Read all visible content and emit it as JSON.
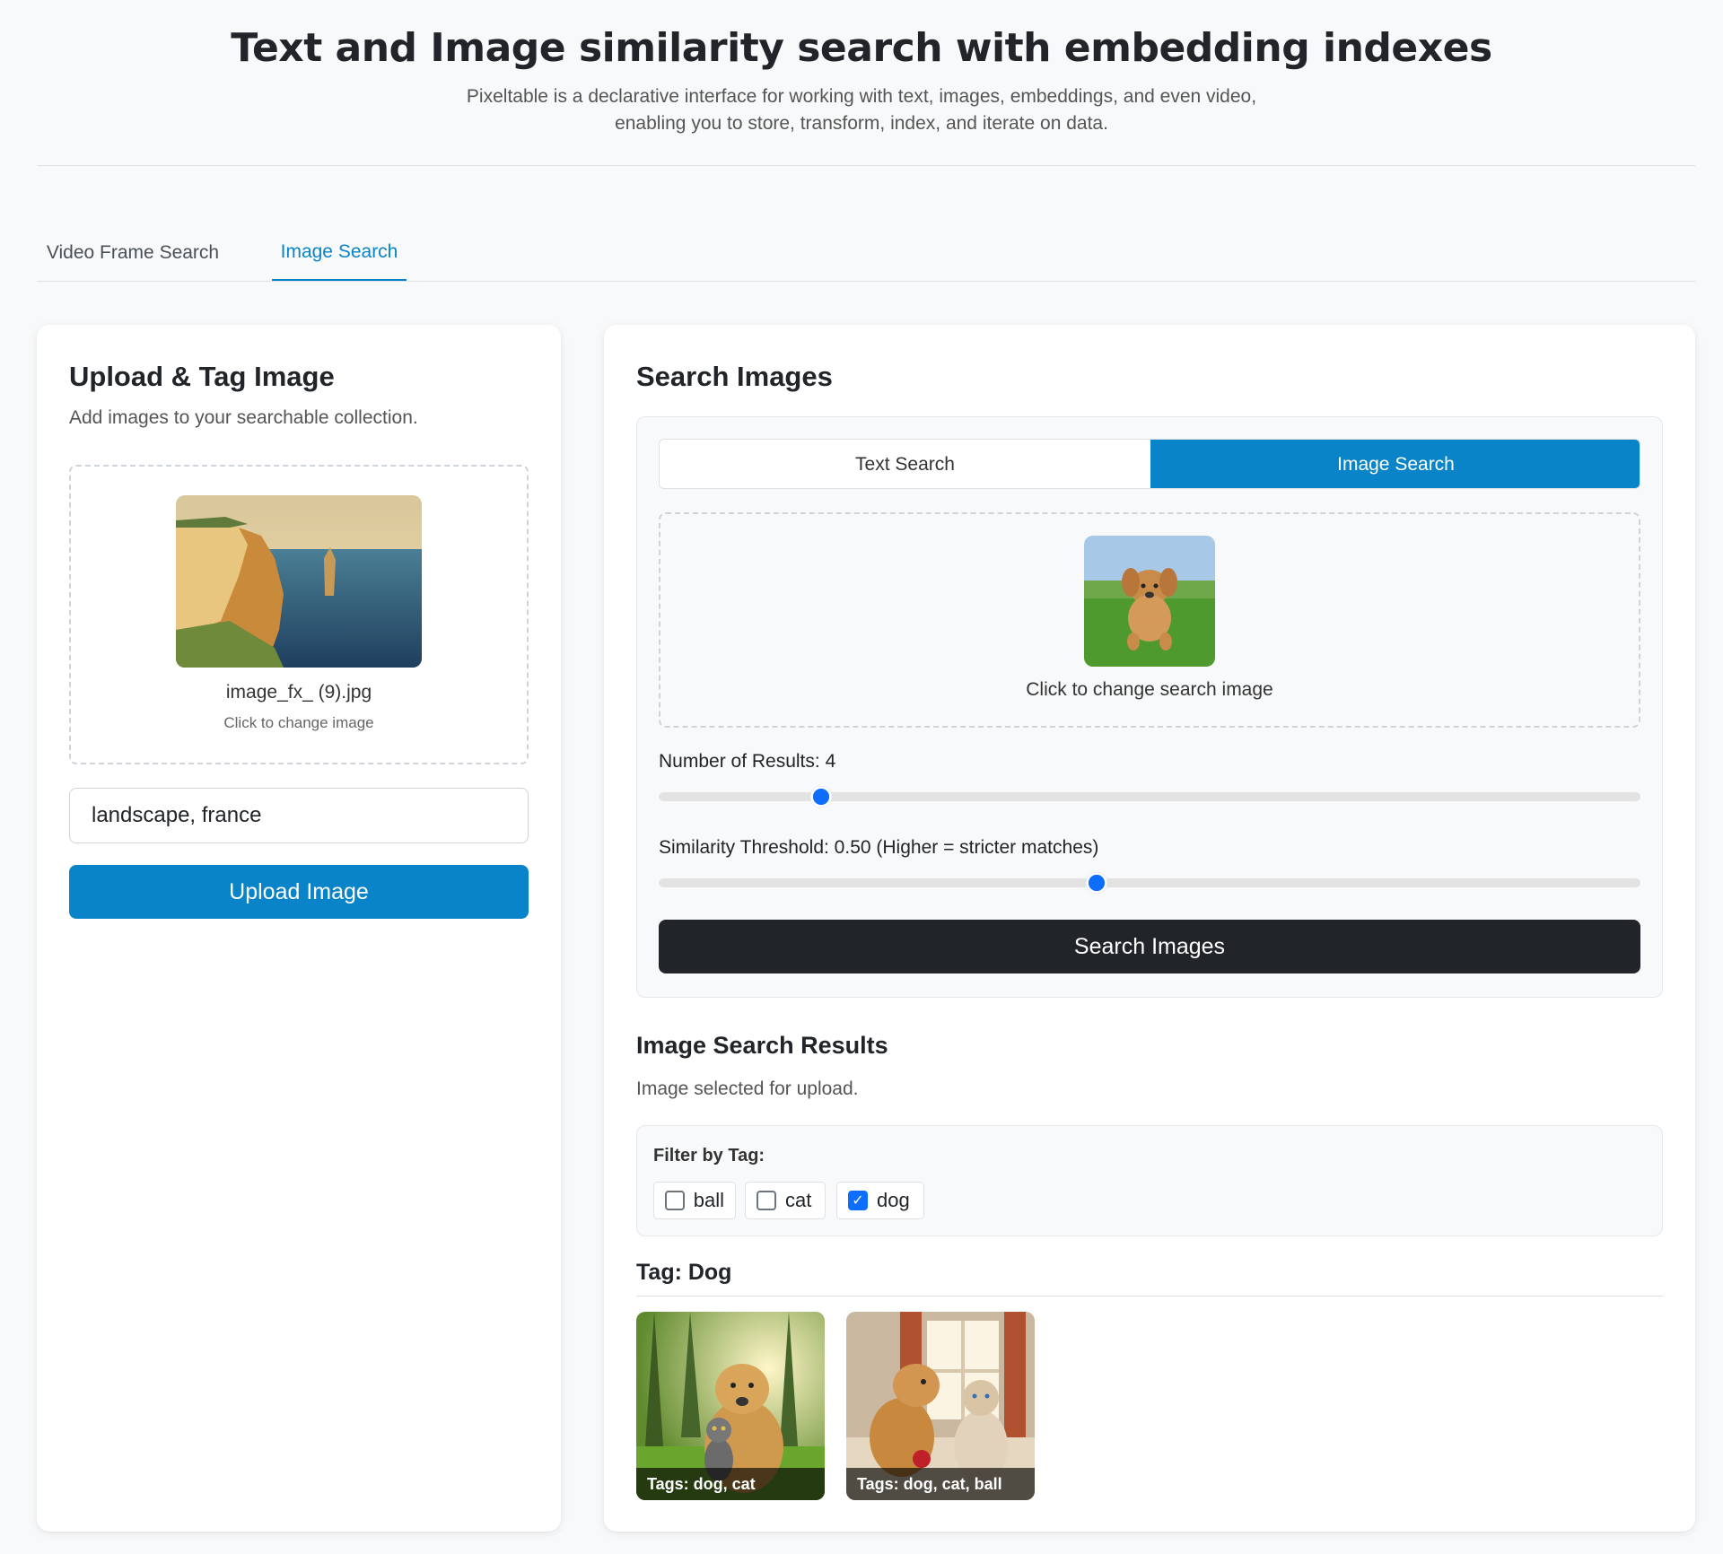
{
  "header": {
    "title": "Text and Image similarity search with embedding indexes",
    "subtitle": "Pixeltable is a declarative interface for working with text, images, embeddings, and even video,\nenabling you to store, transform, index, and iterate on data."
  },
  "tabs": [
    {
      "label": "Video Frame Search",
      "active": false
    },
    {
      "label": "Image Search",
      "active": true
    }
  ],
  "upload_panel": {
    "title": "Upload & Tag Image",
    "description": "Add images to your searchable collection.",
    "file_name": "image_fx_ (9).jpg",
    "change_hint": "Click to change image",
    "tags_value": "landscape, france",
    "upload_button": "Upload Image"
  },
  "search_panel": {
    "title": "Search Images",
    "mode_tabs": [
      {
        "label": "Text Search",
        "active": false
      },
      {
        "label": "Image Search",
        "active": true
      }
    ],
    "change_search_hint": "Click to change search image",
    "num_results_label": "Number of Results: 4",
    "num_results": {
      "value": 4,
      "fraction": 0.165
    },
    "threshold_label": "Similarity Threshold: 0.50 (Higher = stricter matches)",
    "threshold": {
      "value": 0.5,
      "fraction": 0.446
    },
    "search_button": "Search Images"
  },
  "results": {
    "title": "Image Search Results",
    "status": "Image selected for upload.",
    "filter_label": "Filter by Tag:",
    "filters": [
      {
        "label": "ball",
        "checked": false
      },
      {
        "label": "cat",
        "checked": false
      },
      {
        "label": "dog",
        "checked": true
      }
    ],
    "group_title": "Tag: Dog",
    "items": [
      {
        "caption": "Tags: dog, cat"
      },
      {
        "caption": "Tags: dog, cat, ball"
      }
    ]
  },
  "colors": {
    "accent": "#0a84c9",
    "dark_button": "#212529",
    "slider_thumb": "#0d6efd",
    "background": "#f8f9fa"
  }
}
